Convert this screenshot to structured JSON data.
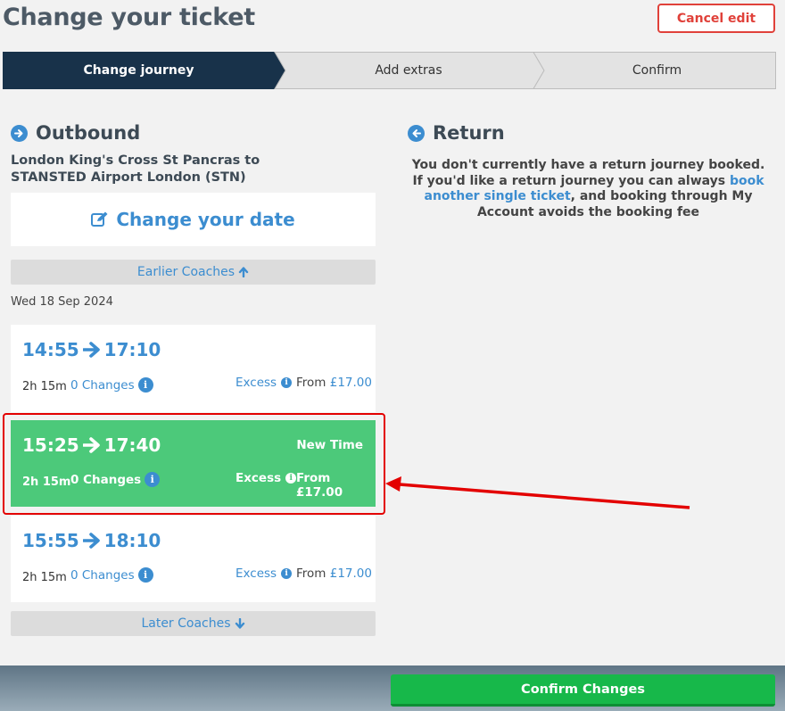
{
  "header": {
    "title": "Change your ticket",
    "cancel_label": "Cancel edit"
  },
  "steps": [
    {
      "label": "Change journey",
      "active": true
    },
    {
      "label": "Add extras",
      "active": false
    },
    {
      "label": "Confirm",
      "active": false
    }
  ],
  "outbound": {
    "heading": "Outbound",
    "route": "London King's Cross St Pancras to STANSTED Airport London (STN)",
    "change_date_label": "Change your date",
    "earlier_label": "Earlier Coaches",
    "later_label": "Later Coaches",
    "date": "Wed 18 Sep 2024",
    "journeys": [
      {
        "depart": "15:25",
        "arrive": "17:40",
        "duration": "2h 15m",
        "changes": "0 Changes",
        "excess": "Excess",
        "from_label": "From",
        "price": "£17.00",
        "tag": "New Time",
        "selected": true
      },
      {
        "depart": "14:55",
        "arrive": "17:10",
        "duration": "2h 15m",
        "changes": "0 Changes",
        "excess": "Excess",
        "from_label": "From",
        "price": "£17.00",
        "tag": "",
        "selected": false
      },
      {
        "depart": "15:55",
        "arrive": "18:10",
        "duration": "2h 15m",
        "changes": "0 Changes",
        "excess": "Excess",
        "from_label": "From",
        "price": "£17.00",
        "tag": "",
        "selected": false
      }
    ]
  },
  "return": {
    "heading": "Return",
    "line1": "You don't currently have a return journey booked.",
    "line2_pre": "If you'd like a return journey you can always ",
    "link": "book another single ticket",
    "line2_post": ", and booking through My Account avoids the booking fee"
  },
  "footer": {
    "confirm_label": "Confirm Changes"
  },
  "colors": {
    "accent": "#3c8dd0",
    "selected": "#4cc97a",
    "step_active": "#18324a",
    "confirm": "#17b84a",
    "cancel": "#e0413a",
    "annotation": "#e30000"
  }
}
